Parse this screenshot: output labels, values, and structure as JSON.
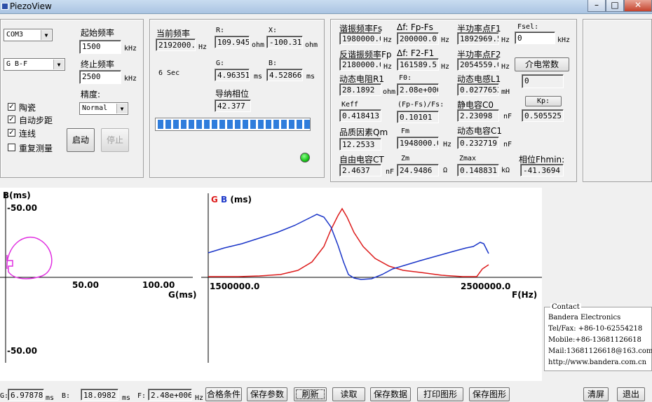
{
  "window": {
    "title": "PiezoView"
  },
  "left": {
    "port": "COM3",
    "mode": "G B-F",
    "start_freq_label": "起始频率",
    "start_freq": "1500",
    "start_unit": "kHz",
    "end_freq_label": "终止频率",
    "end_freq": "2500",
    "end_unit": "kHz",
    "precision_label": "精度:",
    "precision": "Normal",
    "checks": [
      {
        "label": "陶瓷",
        "checked": true
      },
      {
        "label": "自动步距",
        "checked": true
      },
      {
        "label": "连线",
        "checked": true
      },
      {
        "label": "重复测量",
        "checked": false
      }
    ],
    "start_button": "启动",
    "stop_button": "停止"
  },
  "mid": {
    "cur_freq_label": "当前频率",
    "cur_freq": "2192000.0",
    "hz": "Hz",
    "time": "6 Sec",
    "r_label": "R:",
    "r_value": "109.945",
    "x_label": "X:",
    "x_value": "-100.313",
    "ohm": "ohm",
    "g_label": "G:",
    "g_value": "4.96351",
    "b_label": "B:",
    "b_value": "4.52866",
    "ms": "ms",
    "phase_label": "导纳相位",
    "phase_value": "42.377",
    "progress": 1.0
  },
  "params": {
    "fs_label": "谐振频率Fs",
    "fs": "1980000.0",
    "dffs_label": "Δf: Fp-Fs",
    "dffs": "200000.0",
    "f1_label": "半功率点F1",
    "f1": "1892969.5",
    "fsel_label": "Fsel:",
    "fsel": "0",
    "khz": "kHz",
    "fp_label": "反谐振频率Fp",
    "fp": "2180000.0",
    "df21_label": "Δf: F2-F1",
    "df21": "161589.5",
    "f2_label": "半功率点F2",
    "f2": "2054559.0",
    "dielectric_button": "介电常数",
    "dielectric": "0",
    "r1_label": "动态电阻R1",
    "r1": "28.1892",
    "f0_label": "F0:",
    "f0": "2.08e+006",
    "l1_label": "动态电感L1",
    "l1": "0.0277653",
    "mh": "mH",
    "kp_button": "Kp:",
    "kp": "0.505525",
    "keff_label": "Keff",
    "keff": "0.418413",
    "fpfs_label": "(Fp-Fs)/Fs:",
    "fpfs": "0.10101",
    "c0_label": "静电容C0",
    "c0": "2.23098",
    "nf": "nF",
    "qm_label": "品质因素Qm",
    "qm": "12.2533",
    "fm_label": "Fm",
    "fm": "1948000.0",
    "c1_label": "动态电容C1",
    "c1": "0.232719",
    "ct_label": "自由电容CT",
    "ct": "2.4637",
    "zm_label": "Zm",
    "zm": "24.9486",
    "omega": "Ω",
    "zmax_label": "Zmax",
    "zmax": "0.148831",
    "kohm": "kΩ",
    "phmin_label": "相位Fhmin:",
    "phmin": "-41.3694",
    "hz": "Hz",
    "ohm": "ohm"
  },
  "left_plot": {
    "ylabel": "B(ms)",
    "ytick_top": "-50.00",
    "ytick_bottom": "-50.00",
    "xtick1": "50.00",
    "xtick2": "100.00",
    "xlabel": "G(ms)",
    "color": "#e030e0"
  },
  "right_plot": {
    "legend_g": "G",
    "legend_b": "B",
    "legend_unit": "(ms)",
    "x_start": "1500000.0",
    "x_end": "2500000.0",
    "xlabel": "F(Hz)",
    "g_color": "#dd1c1c",
    "b_color": "#1a35c8"
  },
  "contact": {
    "title": "Contact",
    "lines": [
      "Bandera Electronics",
      "Tel/Fax: +86-10-62554218",
      "Mobile:+86-13681126618",
      "Mail:13681126618@163.com",
      "http://www.bandera.com.cn"
    ]
  },
  "status": {
    "g_label": "G:",
    "g": "6.97878",
    "ms": "ms",
    "b_label": "B:",
    "b": "18.0982",
    "f_label": "F:",
    "f": "2.48e+006",
    "hz": "Hz"
  },
  "bottom_buttons": {
    "qualify": "合格条件",
    "save_params": "保存参数",
    "refresh": "刷新",
    "read": "读取",
    "save_data": "保存数据",
    "print": "打印图形",
    "save_graph": "保存图形",
    "clear": "清屏",
    "exit": "退出"
  }
}
